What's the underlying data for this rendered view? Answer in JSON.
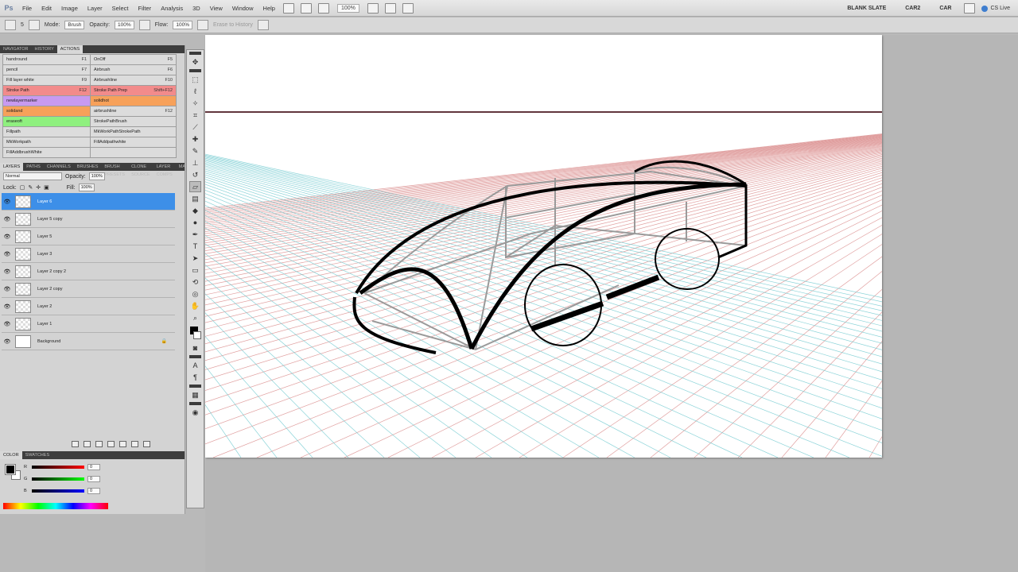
{
  "app": {
    "logo": "Ps"
  },
  "menu": [
    "File",
    "Edit",
    "Image",
    "Layer",
    "Select",
    "Filter",
    "Analysis",
    "3D",
    "View",
    "Window",
    "Help"
  ],
  "menubar": {
    "zoom": "100%"
  },
  "workspaces": [
    "BLANK SLATE",
    "CAR2",
    "CAR"
  ],
  "cs_live": "CS Live",
  "options_bar": {
    "brush_size": "5",
    "mode_label": "Mode:",
    "mode_value": "Brush",
    "opacity_label": "Opacity:",
    "opacity_value": "100%",
    "flow_label": "Flow:",
    "flow_value": "100%",
    "erase_history": "Erase to History"
  },
  "panels": {
    "top_tabs": [
      "NAVIGATOR",
      "HISTORY",
      "ACTIONS"
    ],
    "actions": [
      {
        "label": "handround",
        "key": "F1",
        "color": "#dcdcdc"
      },
      {
        "label": "OnOff",
        "key": "F5",
        "color": "#dcdcdc"
      },
      {
        "label": "pencil",
        "key": "F7",
        "color": "#dcdcdc"
      },
      {
        "label": "Airbrush",
        "key": "F6",
        "color": "#dcdcdc"
      },
      {
        "label": "Fill layer white",
        "key": "F9",
        "color": "#dcdcdc"
      },
      {
        "label": "Airbrushline",
        "key": "F10",
        "color": "#dcdcdc"
      },
      {
        "label": "Stroke Path",
        "key": "F12",
        "color": "#f28b8b"
      },
      {
        "label": "Stroke Path Prep",
        "key": "Shift+F12",
        "color": "#f28b8b"
      },
      {
        "label": "newlayermarker",
        "key": "",
        "color": "#c89af0"
      },
      {
        "label": "solidhot",
        "key": "",
        "color": "#f7a15a"
      },
      {
        "label": "solidand",
        "key": "",
        "color": "#f7a15a"
      },
      {
        "label": "airbrushline",
        "key": "F12",
        "color": "#dcdcdc"
      },
      {
        "label": "eraseoft",
        "key": "",
        "color": "#8ff07f"
      },
      {
        "label": "StrokePathBrush",
        "key": "",
        "color": "#dcdcdc"
      },
      {
        "label": "Fillpath",
        "key": "",
        "color": "#dcdcdc"
      },
      {
        "label": "MkWorkPathStrokePath",
        "key": "",
        "color": "#dcdcdc"
      },
      {
        "label": "MkWorkpath",
        "key": "",
        "color": "#dcdcdc"
      },
      {
        "label": "FillAddpathwhite",
        "key": "",
        "color": "#dcdcdc"
      },
      {
        "label": "FillAddbrushWhite",
        "key": "",
        "color": "#dcdcdc"
      },
      {
        "label": "",
        "key": "",
        "color": "#dcdcdc"
      }
    ],
    "layer_tabs": [
      "LAYERS",
      "PATHS",
      "CHANNELS",
      "BRUSHES",
      "BRUSH PRESETS",
      "CLONE SOURCE",
      "LAYER COMPS",
      "MASKS"
    ],
    "blend_mode": "Normal",
    "opacity_label": "Opacity:",
    "opacity_value": "100%",
    "lock_label": "Lock:",
    "fill_label": "Fill:",
    "fill_value": "100%",
    "layers": [
      {
        "name": "Layer 6",
        "selected": true
      },
      {
        "name": "Layer 5 copy",
        "selected": false
      },
      {
        "name": "Layer 5",
        "selected": false
      },
      {
        "name": "Layer 3",
        "selected": false
      },
      {
        "name": "Layer 2 copy 2",
        "selected": false
      },
      {
        "name": "Layer 2 copy",
        "selected": false
      },
      {
        "name": "Layer 2",
        "selected": false
      },
      {
        "name": "Layer 1",
        "selected": false
      },
      {
        "name": "Background",
        "selected": false
      }
    ],
    "color_tabs": [
      "COLOR",
      "SWATCHES"
    ],
    "color_sliders": [
      {
        "label": "R",
        "value": "0"
      },
      {
        "label": "G",
        "value": "0"
      },
      {
        "label": "B",
        "value": "0"
      }
    ]
  },
  "icons": {
    "eye": "eye-icon",
    "lock": "lock-icon"
  }
}
